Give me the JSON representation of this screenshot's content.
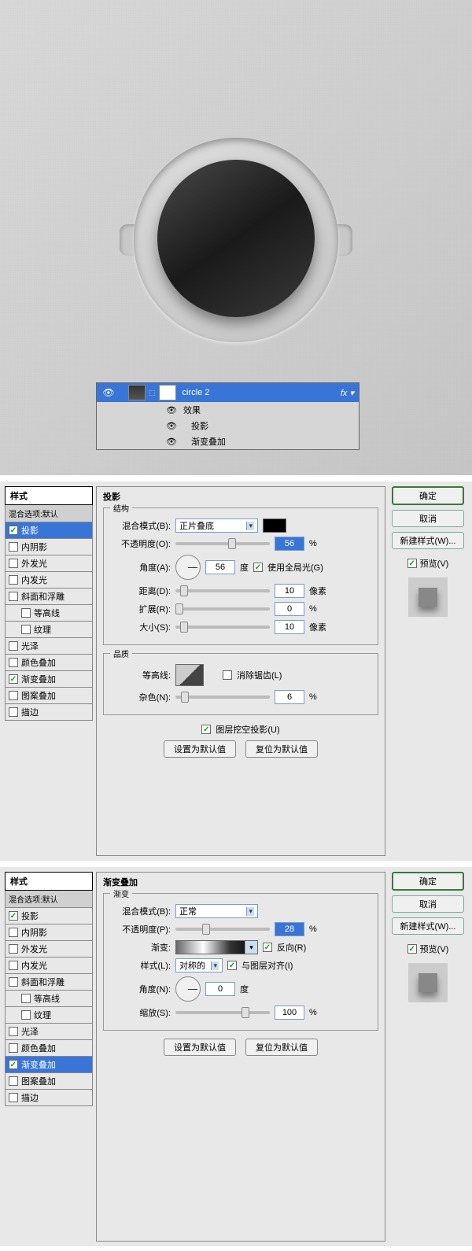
{
  "canvas": {
    "layer_name": "circle 2",
    "effects_label": "效果",
    "effect_1": "投影",
    "effect_2": "渐变叠加"
  },
  "dialog1": {
    "title": "投影",
    "section_structure": "结构",
    "section_quality": "品质",
    "blend_mode_label": "混合模式(B):",
    "blend_mode_value": "正片叠底",
    "opacity_label": "不透明度(O):",
    "opacity_value": "56",
    "angle_label": "角度(A):",
    "angle_value": "56",
    "angle_unit": "度",
    "global_light": "使用全局光(G)",
    "distance_label": "距离(D):",
    "distance_value": "10",
    "distance_unit": "像素",
    "spread_label": "扩展(R):",
    "spread_value": "0",
    "size_label": "大小(S):",
    "size_value": "10",
    "size_unit": "像素",
    "contour_label": "等高线:",
    "antialias": "消除锯齿(L)",
    "noise_label": "杂色(N):",
    "noise_value": "6",
    "knockout": "图层挖空投影(U)",
    "set_default": "设置为默认值",
    "reset_default": "复位为默认值"
  },
  "dialog2": {
    "title": "渐变叠加",
    "section_gradient": "渐变",
    "blend_mode_label": "混合模式(B):",
    "blend_mode_value": "正常",
    "opacity_label": "不透明度(P):",
    "opacity_value": "28",
    "gradient_label": "渐变:",
    "reverse": "反向(R)",
    "style_label": "样式(L):",
    "style_value": "对称的",
    "align_layer": "与图层对齐(I)",
    "angle_label": "角度(N):",
    "angle_value": "0",
    "angle_unit": "度",
    "scale_label": "缩放(S):",
    "scale_value": "100",
    "set_default": "设置为默认值",
    "reset_default": "复位为默认值"
  },
  "styles": {
    "heading": "样式",
    "blending": "混合选项:默认",
    "s1": "投影",
    "s2": "内阴影",
    "s3": "外发光",
    "s4": "内发光",
    "s5": "斜面和浮雕",
    "s5a": "等高线",
    "s5b": "纹理",
    "s6": "光泽",
    "s7": "颜色叠加",
    "s8": "渐变叠加",
    "s9": "图案叠加",
    "s10": "描边"
  },
  "actions": {
    "ok": "确定",
    "cancel": "取消",
    "new_style": "新建样式(W)...",
    "preview": "预览(V)"
  },
  "percent": "%"
}
